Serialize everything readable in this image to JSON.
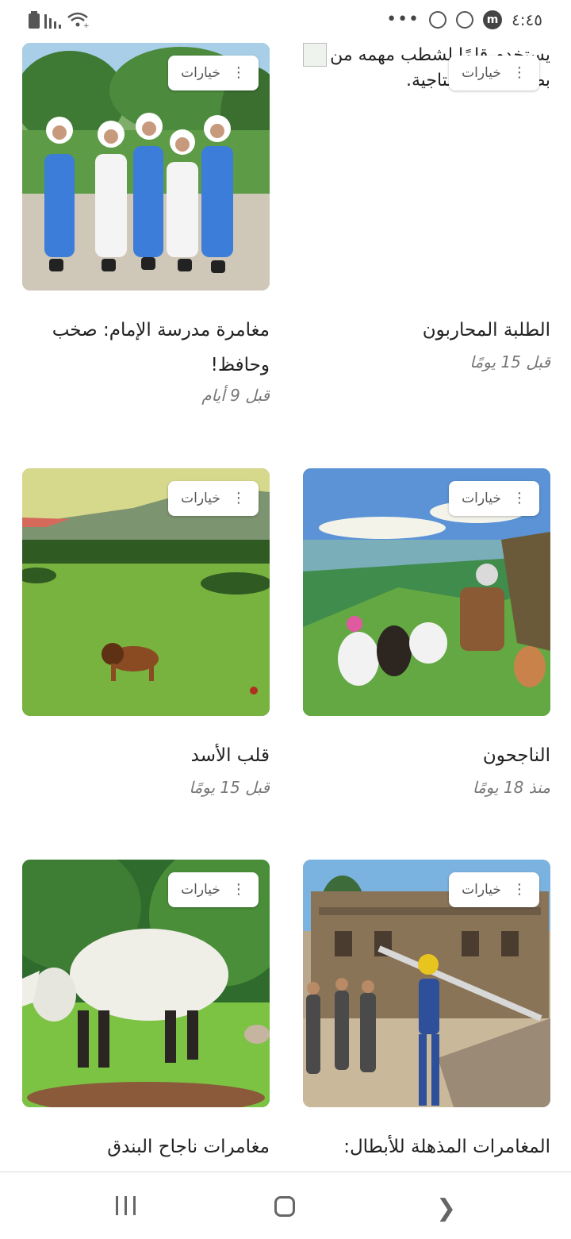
{
  "status_bar": {
    "time": "٤:٤٥",
    "overflow": "•••",
    "messenger_badge": "m",
    "icons": [
      "battery-icon",
      "signal-icon",
      "wifi-icon",
      "viber-icon",
      "viber-icon",
      "messenger-icon"
    ]
  },
  "options_label": "خيارات",
  "stories": [
    {
      "title": "مغامرة مدرسة الإمام: صخب وحافظ!",
      "time": "قبل 9 أيام",
      "image": "girls-in-school-uniforms"
    },
    {
      "title": "الطلبة المحاربون",
      "time": "قبل 15 يومًا",
      "image": "broken-image",
      "alt_text": "يستخدم قلمًا لشطب مهمه من بطاقة ورقية إنتاجية."
    },
    {
      "title": "قلب الأسد",
      "time": "قبل 15 يومًا",
      "image": "lion-in-savanna"
    },
    {
      "title": "الناجحون",
      "time": "منذ 18 يومًا",
      "image": "animals-on-hill"
    },
    {
      "title": "مغامرات ناجاح البندق",
      "time": "",
      "image": "fluffy-animal-in-forest"
    },
    {
      "title": "المغامرات المذهلة للأبطال:",
      "time": "",
      "image": "heroes-in-ruins"
    }
  ],
  "nav_bar": {
    "icons": [
      "recents-icon",
      "home-icon",
      "back-icon"
    ]
  }
}
